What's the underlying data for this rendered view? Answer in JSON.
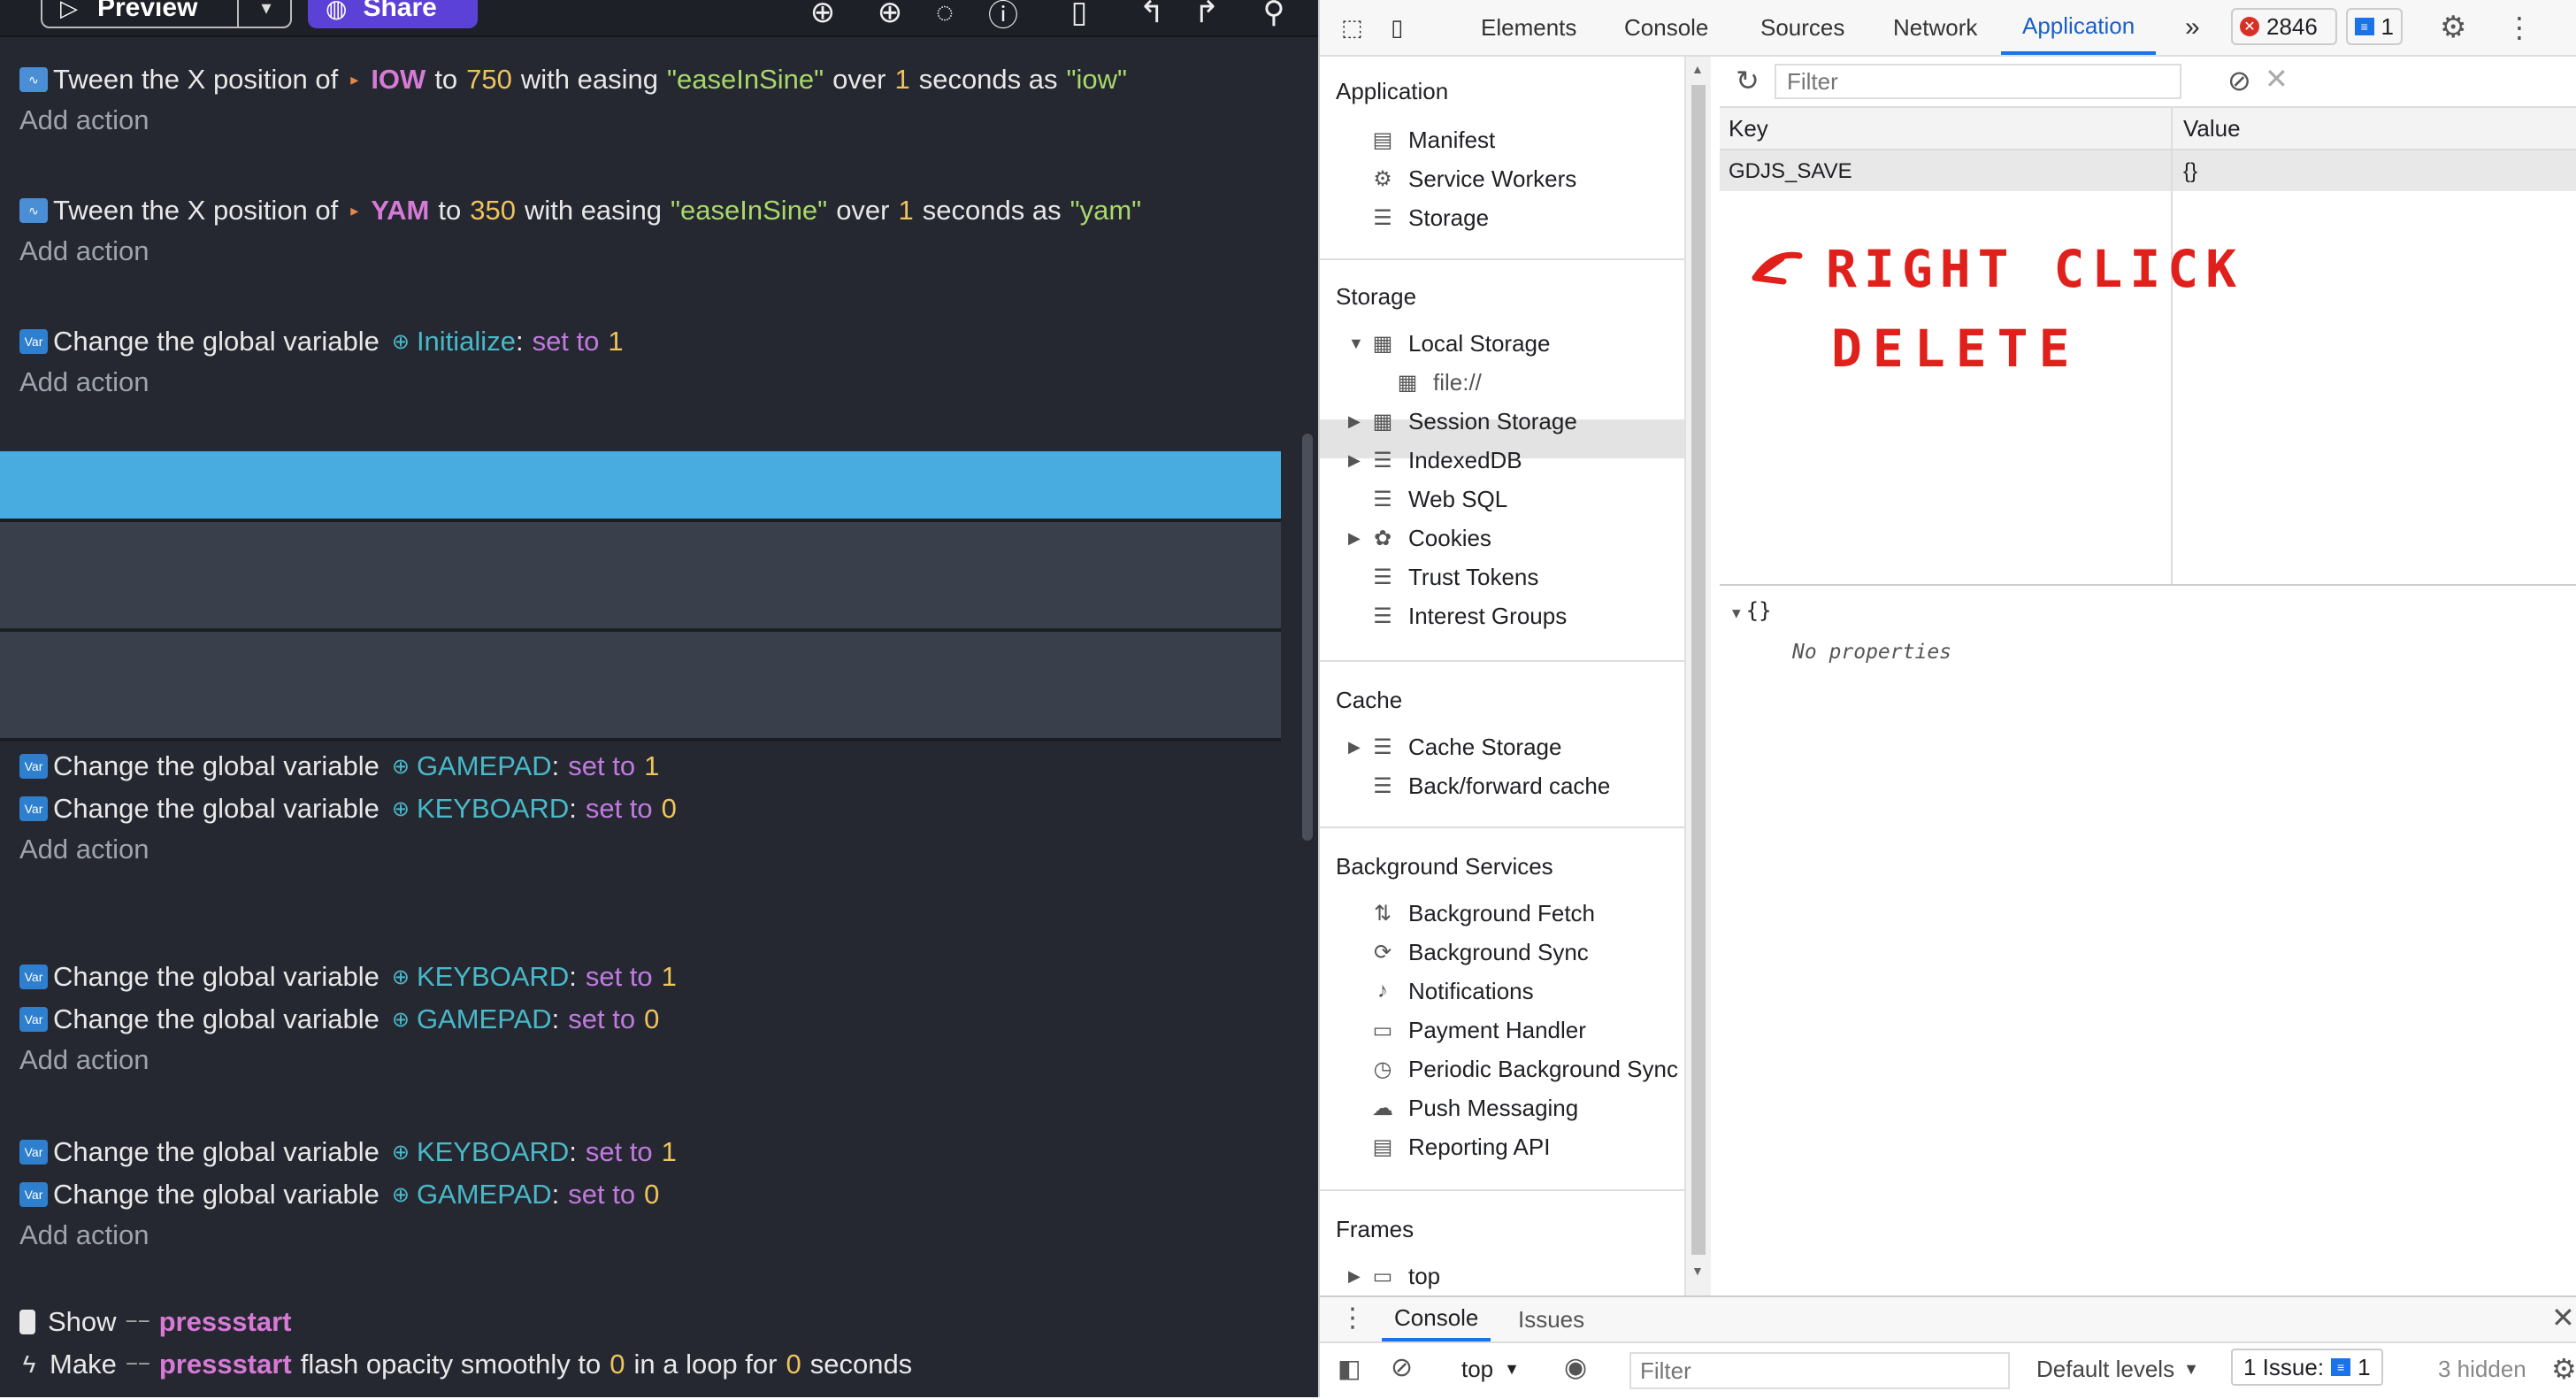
{
  "gdevelop": {
    "toolbar": {
      "preview_label": "Preview",
      "share_label": "Share"
    },
    "events": [
      {
        "kind": "tween",
        "obj": "IOW",
        "target": "750",
        "easing": "\"easeInSine\"",
        "duration": "1",
        "id": "\"iow\""
      },
      {
        "kind": "tween",
        "obj": "YAM",
        "target": "350",
        "easing": "\"easeInSine\"",
        "duration": "1",
        "id": "\"yam\""
      },
      {
        "kind": "var",
        "name": "Initialize",
        "value": "1"
      }
    ],
    "text": {
      "tween_prefix": "Tween the X position of",
      "to": "to",
      "with_easing": "with easing",
      "over": "over",
      "seconds_as": "seconds as",
      "change_global": "Change the global variable",
      "set_to": "set to",
      "add_action": "Add action",
      "show": "Show",
      "make": "Make",
      "flash": "flash opacity smoothly to",
      "in_loop_for": "in a loop for",
      "seconds": "seconds"
    },
    "vars": {
      "gamepad": "GAMEPAD",
      "keyboard": "KEYBOARD",
      "one": "1",
      "zero": "0"
    },
    "pressstart": "pressstart"
  },
  "devtools": {
    "tabs": [
      "Elements",
      "Console",
      "Sources",
      "Network",
      "Application"
    ],
    "more": "»",
    "errors_count": "2846",
    "messages_count": "1",
    "sidebar": {
      "application_header": "Application",
      "application_items": [
        "Manifest",
        "Service Workers",
        "Storage"
      ],
      "storage_header": "Storage",
      "storage_items": [
        "Local Storage",
        "file://",
        "Session Storage",
        "IndexedDB",
        "Web SQL",
        "Cookies",
        "Trust Tokens",
        "Interest Groups"
      ],
      "cache_header": "Cache",
      "cache_items": [
        "Cache Storage",
        "Back/forward cache"
      ],
      "bg_header": "Background Services",
      "bg_items": [
        "Background Fetch",
        "Background Sync",
        "Notifications",
        "Payment Handler",
        "Periodic Background Sync",
        "Push Messaging",
        "Reporting API"
      ],
      "frames_header": "Frames",
      "frames_items": [
        "top"
      ]
    },
    "storage_view": {
      "filter_placeholder": "Filter",
      "col_key": "Key",
      "col_value": "Value",
      "row_key": "GDJS_SAVE",
      "row_value": "{}",
      "preview_root": "{}",
      "no_properties": "No properties"
    },
    "annotation": {
      "line1": "RIGHT CLICK",
      "line2": "DELETE",
      "color": "#e0201b"
    },
    "drawer": {
      "tabs": [
        "Console",
        "Issues"
      ],
      "context": "top",
      "filter_placeholder": "Filter",
      "levels": "Default levels",
      "issues_label": "1 Issue:",
      "issues_count": "1",
      "hidden": "3 hidden"
    }
  }
}
